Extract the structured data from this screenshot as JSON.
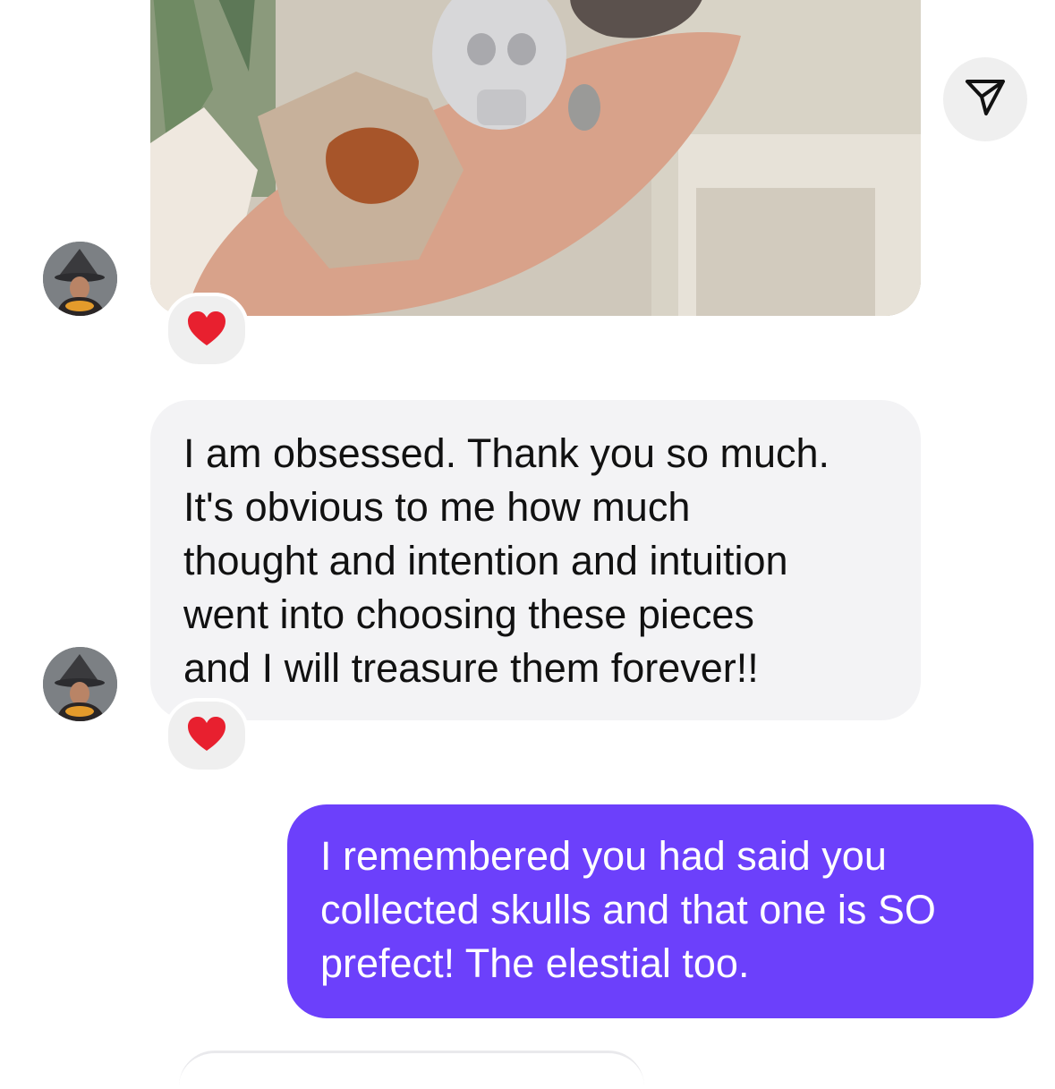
{
  "messages": [
    {
      "type": "image",
      "sender": "them",
      "image_description": "hand holding crystals and a skull",
      "reaction": "❤️"
    },
    {
      "type": "text",
      "sender": "them",
      "text": "I am obsessed. Thank you so much.\nIt's obvious to me how much\nthought and intention and intuition\nwent into choosing these pieces\nand I will treasure them forever!!",
      "reaction": "❤️"
    },
    {
      "type": "text",
      "sender": "me",
      "text": "I remembered you had said you\ncollected skulls and that one is SO\nprefect! The elestial too."
    }
  ],
  "icons": {
    "share": "paper-plane-icon",
    "reaction": "heart-icon"
  },
  "colors": {
    "outgoing_bubble": "#6c40fb",
    "incoming_bubble": "#f3f3f5",
    "reaction_bg": "#efefef",
    "heart": "#e8202f"
  }
}
